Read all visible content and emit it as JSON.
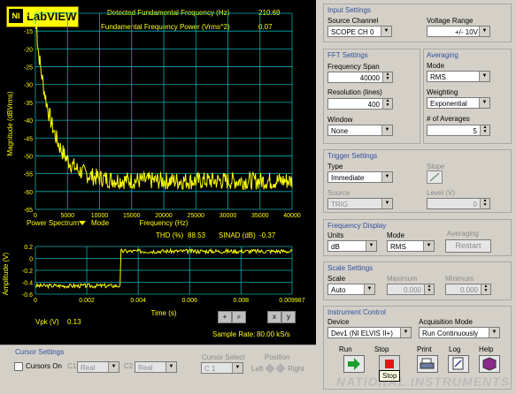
{
  "logo": {
    "text": "LabVIEW",
    "mark": "NI"
  },
  "readouts": {
    "fundamental_freq_label": "Detected Fundamental Frequency (Hz)",
    "fundamental_freq_value": "210.69",
    "fundamental_power_label": "Fundamental Frequency Power (Vrms^2)",
    "fundamental_power_value": "0.07",
    "thd_label": "THD (%)",
    "thd_value": "88.53",
    "sinad_label": "SINAD (dB)",
    "sinad_value": "-0.37",
    "vpk_label": "Vpk (V)",
    "vpk_value": "0.13",
    "sample_rate_label": "Sample Rate:",
    "sample_rate_value": "80.00 kS/s"
  },
  "spectrum_graph": {
    "ylabel": "Magnitude (dBVrms)",
    "xlabel": "Frequency (Hz)",
    "mode_label": "Power Spectrum",
    "mode_suffix": "Mode",
    "yticks": [
      "-10",
      "-15",
      "-20",
      "-25",
      "-30",
      "-35",
      "-40",
      "-45",
      "-50",
      "-55",
      "-60",
      "-65"
    ],
    "xticks": [
      "0",
      "5000",
      "10000",
      "15000",
      "20000",
      "25000",
      "30000",
      "35000",
      "40000"
    ]
  },
  "time_graph": {
    "ylabel": "Amplitude (V)",
    "xlabel": "Time (s)",
    "yticks": [
      "0.2",
      "0",
      "-0.2",
      "-0.4",
      "-0.6"
    ],
    "xticks": [
      "0",
      "0.002",
      "0.004",
      "0.006",
      "0.008",
      "0.009987"
    ]
  },
  "cursor_settings": {
    "title": "Cursor Settings",
    "cursors_on_label": "Cursors On",
    "c1_label": "C1",
    "c1_value": "Real",
    "c2_label": "C2",
    "c2_value": "Real",
    "cursor_select_label": "Cursor Select",
    "cursor_select_value": "C 1",
    "position_label": "Position",
    "left_label": "Left",
    "right_label": "Right"
  },
  "input_settings": {
    "title": "Input Settings",
    "source_channel_label": "Source Channel",
    "source_channel_value": "SCOPE CH 0",
    "voltage_range_label": "Voltage Range",
    "voltage_range_value": "+/- 10V"
  },
  "fft_settings": {
    "title": "FFT Settings",
    "frequency_span_label": "Frequency Span",
    "frequency_span_value": "40000",
    "resolution_label": "Resolution (lines)",
    "resolution_value": "400",
    "window_label": "Window",
    "window_value": "None"
  },
  "averaging": {
    "title": "Averaging",
    "mode_label": "Mode",
    "mode_value": "RMS",
    "weighting_label": "Weighting",
    "weighting_value": "Exponential",
    "num_averages_label": "# of Averages",
    "num_averages_value": "5"
  },
  "trigger_settings": {
    "title": "Trigger Settings",
    "type_label": "Type",
    "type_value": "Immediate",
    "slope_label": "Slope",
    "source_label": "Source",
    "source_value": "TRIG",
    "level_label": "Level (V)",
    "level_value": "0"
  },
  "frequency_display": {
    "title": "Frequency Display",
    "units_label": "Units",
    "units_value": "dB",
    "mode_label": "Mode",
    "mode_value": "RMS",
    "averaging_label": "Averaging",
    "restart_label": "Restart"
  },
  "scale_settings": {
    "title": "Scale Settings",
    "scale_label": "Scale",
    "scale_value": "Auto",
    "maximum_label": "Maximum",
    "maximum_value": "0.000",
    "minimum_label": "Minimum",
    "minimum_value": "0.000"
  },
  "instrument_control": {
    "title": "Instrument Control",
    "device_label": "Device",
    "device_value": "Dev1 (NI ELVIS II+)",
    "acquisition_mode_label": "Acquisition Mode",
    "acquisition_mode_value": "Run Continuously"
  },
  "actions": {
    "run_label": "Run",
    "stop_label": "Stop",
    "print_label": "Print",
    "log_label": "Log",
    "help_label": "Help"
  },
  "tooltip": "Stop",
  "watermark": "NATIONAL INSTRUMENTS",
  "colors": {
    "panel_bg": "#000000",
    "readout": "#ffff00",
    "grid": "#00b0b0",
    "trace": "#ffff00",
    "group_title": "#3050a0"
  }
}
